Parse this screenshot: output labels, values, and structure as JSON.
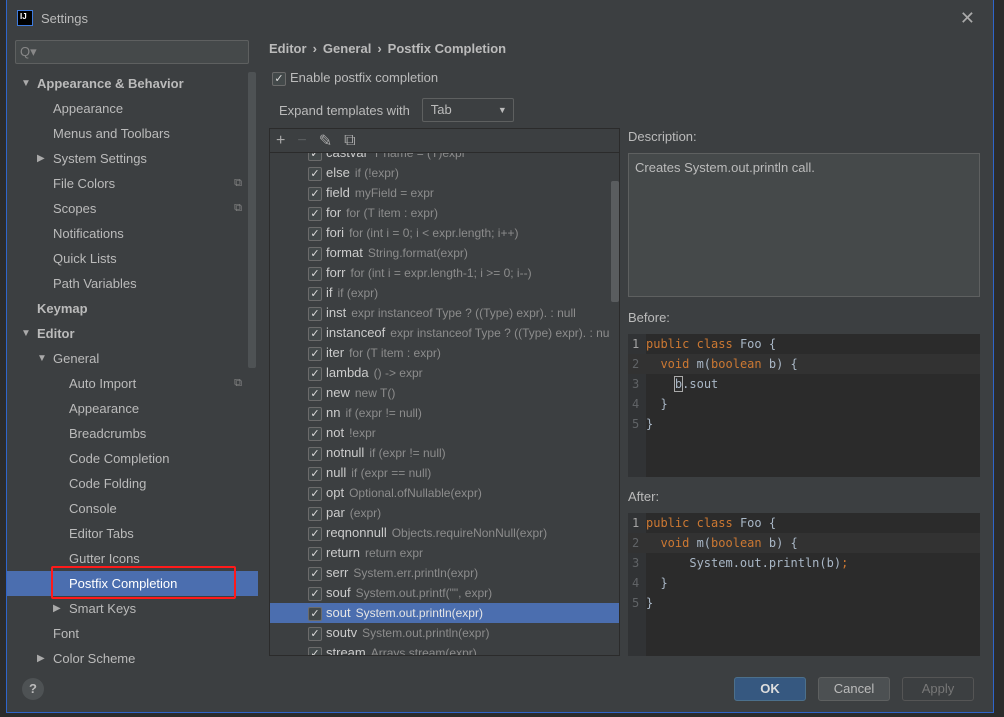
{
  "window": {
    "title": "Settings",
    "logo_text": "IJ"
  },
  "search": {
    "placeholder": "Q▾"
  },
  "sidebar": {
    "items": [
      {
        "label": "Appearance & Behavior",
        "level": 0,
        "bold": true,
        "arrow": "▼"
      },
      {
        "label": "Appearance",
        "level": 1
      },
      {
        "label": "Menus and Toolbars",
        "level": 1
      },
      {
        "label": "System Settings",
        "level": 1,
        "arrow": "▶"
      },
      {
        "label": "File Colors",
        "level": 1,
        "copy": true
      },
      {
        "label": "Scopes",
        "level": 1,
        "copy": true
      },
      {
        "label": "Notifications",
        "level": 1
      },
      {
        "label": "Quick Lists",
        "level": 1
      },
      {
        "label": "Path Variables",
        "level": 1
      },
      {
        "label": "Keymap",
        "level": 0,
        "bold": true
      },
      {
        "label": "Editor",
        "level": 0,
        "bold": true,
        "arrow": "▼"
      },
      {
        "label": "General",
        "level": 1,
        "arrow": "▼"
      },
      {
        "label": "Auto Import",
        "level": 2,
        "copy": true
      },
      {
        "label": "Appearance",
        "level": 2
      },
      {
        "label": "Breadcrumbs",
        "level": 2
      },
      {
        "label": "Code Completion",
        "level": 2
      },
      {
        "label": "Code Folding",
        "level": 2
      },
      {
        "label": "Console",
        "level": 2
      },
      {
        "label": "Editor Tabs",
        "level": 2
      },
      {
        "label": "Gutter Icons",
        "level": 2
      },
      {
        "label": "Postfix Completion",
        "level": 2,
        "selected": true
      },
      {
        "label": "Smart Keys",
        "level": 2,
        "arrow": "▶"
      },
      {
        "label": "Font",
        "level": 1
      },
      {
        "label": "Color Scheme",
        "level": 1,
        "arrow": "▶"
      }
    ]
  },
  "breadcrumb": [
    "Editor",
    "›",
    "General",
    "›",
    "Postfix Completion"
  ],
  "enable": {
    "label": "Enable postfix completion",
    "checked": true
  },
  "expand": {
    "label": "Expand templates with",
    "value": "Tab"
  },
  "toolbar": {
    "add": "+",
    "remove": "−",
    "edit": "✎",
    "copy": "⧉"
  },
  "templates": [
    {
      "key": "castvar",
      "desc": "T name = (T)expr"
    },
    {
      "key": "else",
      "desc": "if (!expr)"
    },
    {
      "key": "field",
      "desc": "myField = expr"
    },
    {
      "key": "for",
      "desc": "for (T item : expr)"
    },
    {
      "key": "fori",
      "desc": "for (int i = 0; i < expr.length; i++)"
    },
    {
      "key": "format",
      "desc": "String.format(expr)"
    },
    {
      "key": "forr",
      "desc": "for (int i = expr.length-1; i >= 0; i--)"
    },
    {
      "key": "if",
      "desc": "if (expr)"
    },
    {
      "key": "inst",
      "desc": "expr instanceof Type ? ((Type) expr). : null"
    },
    {
      "key": "instanceof",
      "desc": "expr instanceof Type ? ((Type) expr). : nu"
    },
    {
      "key": "iter",
      "desc": "for (T item : expr)"
    },
    {
      "key": "lambda",
      "desc": "() -> expr"
    },
    {
      "key": "new",
      "desc": "new T()"
    },
    {
      "key": "nn",
      "desc": "if (expr != null)"
    },
    {
      "key": "not",
      "desc": "!expr"
    },
    {
      "key": "notnull",
      "desc": "if (expr != null)"
    },
    {
      "key": "null",
      "desc": "if (expr == null)"
    },
    {
      "key": "opt",
      "desc": "Optional.ofNullable(expr)"
    },
    {
      "key": "par",
      "desc": "(expr)"
    },
    {
      "key": "reqnonnull",
      "desc": "Objects.requireNonNull(expr)"
    },
    {
      "key": "return",
      "desc": "return expr"
    },
    {
      "key": "serr",
      "desc": "System.err.println(expr)"
    },
    {
      "key": "souf",
      "desc": "System.out.printf(\"\", expr)"
    },
    {
      "key": "sout",
      "desc": "System.out.println(expr)",
      "selected": true
    },
    {
      "key": "soutv",
      "desc": "System.out.println(expr)"
    },
    {
      "key": "stream",
      "desc": "Arrays.stream(expr)"
    }
  ],
  "description": {
    "label": "Description:",
    "text": "Creates System.out.println call."
  },
  "before": {
    "label": "Before:",
    "lines": [
      "public class Foo {",
      "  void m(boolean b) {",
      "    b.sout",
      "  }",
      "}"
    ]
  },
  "after": {
    "label": "After:",
    "lines": [
      "public class Foo {",
      "  void m(boolean b) {",
      "      System.out.println(b);",
      "  }",
      "}"
    ]
  },
  "footer": {
    "help": "?",
    "ok": "OK",
    "cancel": "Cancel",
    "apply": "Apply"
  },
  "colors": {
    "selection": "#4b6eaf",
    "highlight_box": "#ff1a1a",
    "keyword": "#cc7832",
    "ok_button": "#365880"
  }
}
